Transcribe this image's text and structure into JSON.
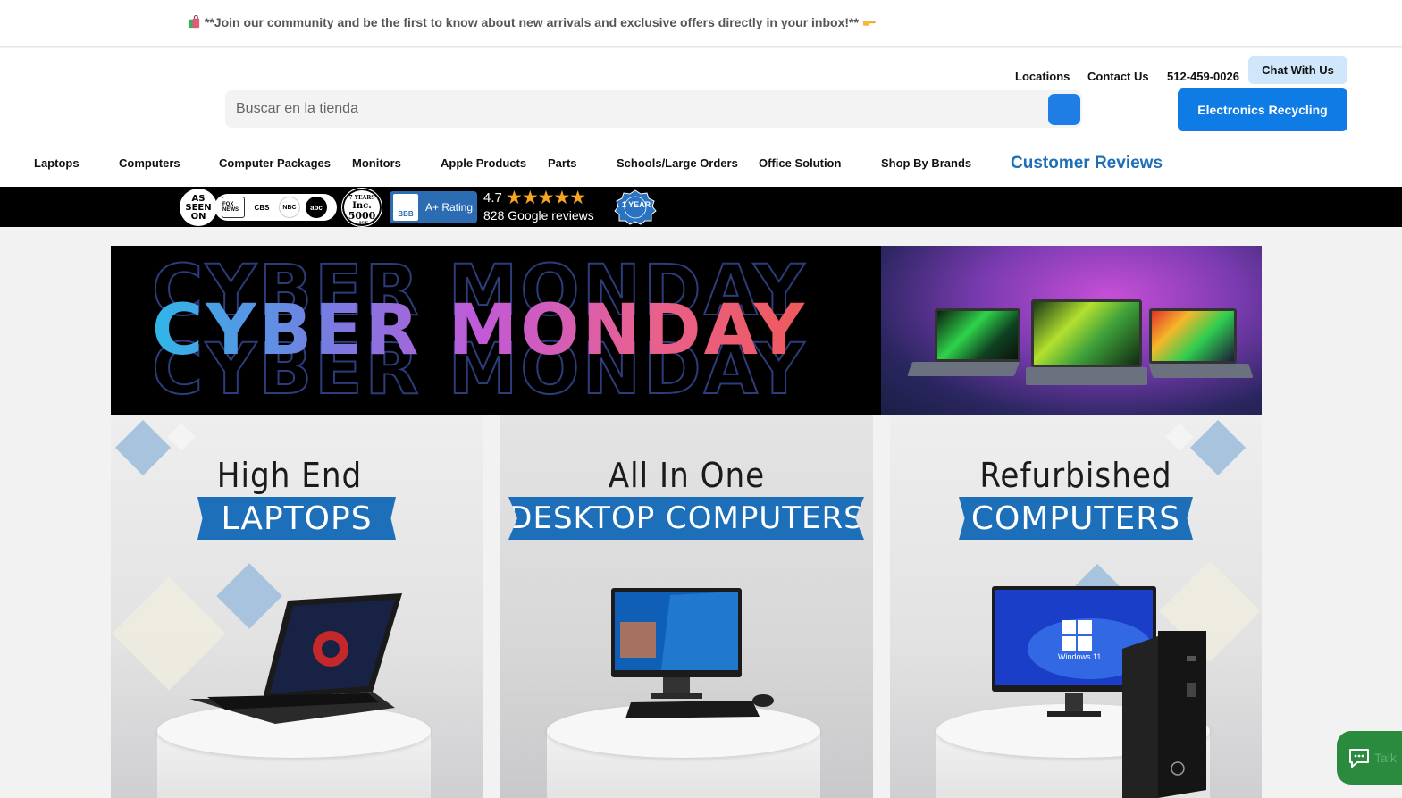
{
  "announcement": {
    "icon": "shopping-bags-icon",
    "text": "**Join our community and be the first to know about new arrivals and exclusive offers directly in your inbox!**",
    "trailing_icon": "pointing-hand-icon"
  },
  "utility_nav": {
    "locations": "Locations",
    "contact": "Contact Us",
    "phone": "512-459-0026",
    "chat": "Chat With Us"
  },
  "search": {
    "placeholder": "Buscar en la tienda",
    "button_icon": "search-icon"
  },
  "recycling_button": "Electronics Recycling",
  "main_nav": {
    "items": [
      {
        "label": "Laptops"
      },
      {
        "label": "Computers"
      },
      {
        "label": "Computer Packages"
      },
      {
        "label": "Monitors"
      },
      {
        "label": "Apple Products"
      },
      {
        "label": "Parts"
      },
      {
        "label": "Schools/Large Orders"
      },
      {
        "label": "Office Solution"
      },
      {
        "label": "Shop By Brands"
      }
    ],
    "reviews": "Customer Reviews",
    "reviews_color": "#1f6fb8"
  },
  "trust_strip": {
    "as_seen_on": [
      "AS",
      "SEEN",
      "ON"
    ],
    "media": [
      "FOX NEWS",
      "CBS",
      "NBC",
      "abc"
    ],
    "inc": {
      "top": "7 YEARS",
      "mid": "Inc.",
      "num": "5000",
      "bottom": "LIST"
    },
    "bbb": {
      "logo": "BBB",
      "rating": "A+ Rating"
    },
    "google": {
      "score": "4.7",
      "stars": "★★★★★",
      "reviews": "828 Google reviews"
    },
    "warranty": "1 YEAR"
  },
  "hero": {
    "title": "CYBER MONDAY",
    "gradient": [
      "#2fb6e8",
      "#c15ad8",
      "#ef5a5a"
    ]
  },
  "categories": [
    {
      "top": "High End",
      "ribbon": "LAPTOPS"
    },
    {
      "top": "All In One",
      "ribbon": "DESKTOP COMPUTERS"
    },
    {
      "top": "Refurbished",
      "ribbon": "COMPUTERS",
      "screen_text": "Windows 11"
    }
  ],
  "talk_widget": {
    "label": "Talk",
    "icon": "chat-bubble-icon"
  },
  "colors": {
    "accent": "#0f7be5",
    "chat_bg": "#cfe6fb",
    "ribbon": "#1c6fb8",
    "talk": "#2a8a3e"
  }
}
